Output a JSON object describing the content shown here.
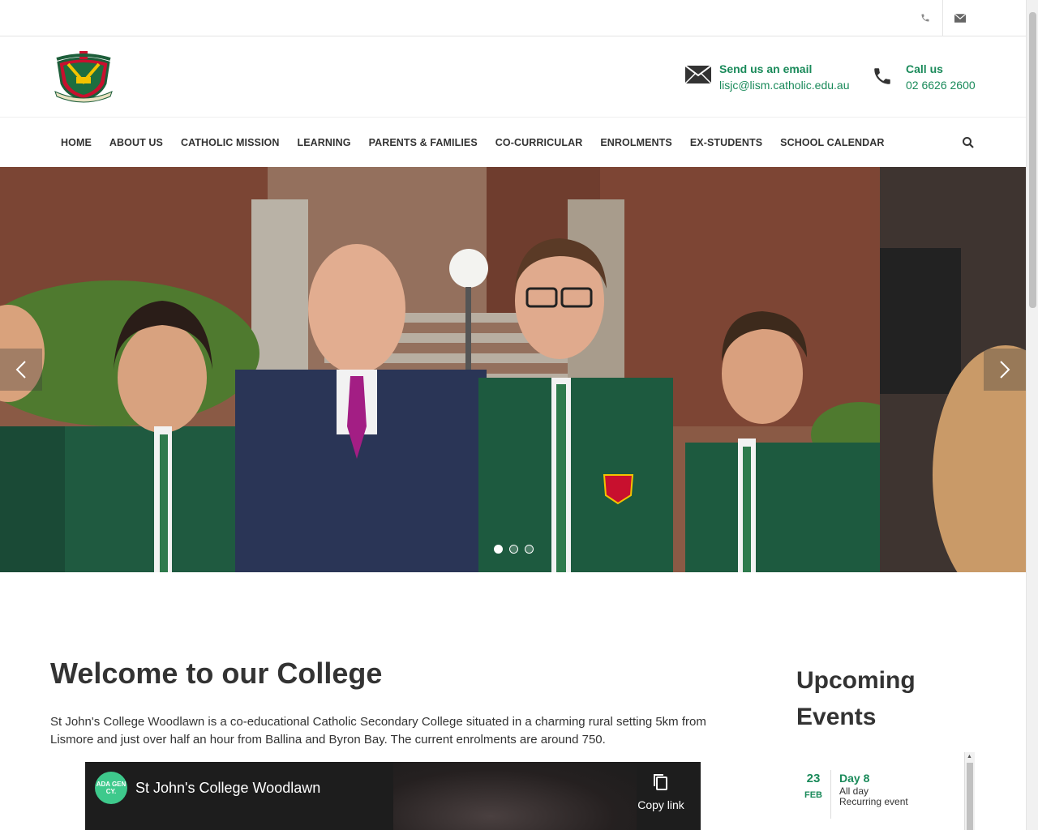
{
  "topbar": {
    "icons": [
      "phone-icon",
      "mail-icon"
    ]
  },
  "header": {
    "logo_alt": "St John's College Woodlawn crest",
    "email": {
      "title": "Send us an email",
      "value": "lisjc@lism.catholic.edu.au"
    },
    "call": {
      "title": "Call us",
      "value": "02 6626 2600"
    }
  },
  "nav": {
    "items": [
      "HOME",
      "ABOUT US",
      "CATHOLIC MISSION",
      "LEARNING",
      "PARENTS & FAMILIES",
      "CO-CURRICULAR",
      "ENROLMENTS",
      "EX-STUDENTS",
      "SCHOOL CALENDAR"
    ],
    "search_icon": "search-icon"
  },
  "hero": {
    "slides": 3,
    "active_slide": 1
  },
  "main": {
    "title": "Welcome to our College",
    "intro": "St John's College Woodlawn is a co-educational Catholic Secondary College situated in a charming rural setting 5km from Lismore and just over half an hour from Ballina and Byron Bay. The current enrolments are around 750.",
    "video": {
      "channel_logo": "ADA GEN CY.",
      "title": "St John's College Woodlawn",
      "copy_label": "Copy link"
    }
  },
  "sidebar": {
    "title": "Upcoming Events",
    "events": [
      {
        "day": "23",
        "month": "FEB",
        "title": "Day 8",
        "line1": "All day",
        "line2": "Recurring event"
      }
    ]
  },
  "colors": {
    "accent": "#1a8a5a",
    "text": "#333333"
  }
}
